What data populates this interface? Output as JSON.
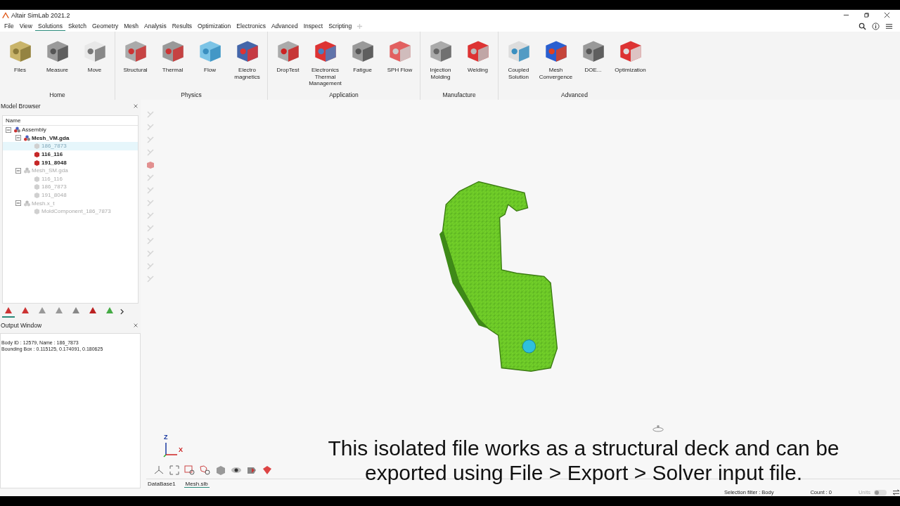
{
  "window": {
    "title": "Altair SimLab 2021.2"
  },
  "menu": [
    {
      "label": "File",
      "selected": false
    },
    {
      "label": "View",
      "selected": false
    },
    {
      "label": "Solutions",
      "selected": true
    },
    {
      "label": "Sketch",
      "selected": false
    },
    {
      "label": "Geometry",
      "selected": false
    },
    {
      "label": "Mesh",
      "selected": false
    },
    {
      "label": "Analysis",
      "selected": false
    },
    {
      "label": "Results",
      "selected": false
    },
    {
      "label": "Optimization",
      "selected": false
    },
    {
      "label": "Electronics",
      "selected": false
    },
    {
      "label": "Advanced",
      "selected": false
    },
    {
      "label": "Inspect",
      "selected": false
    },
    {
      "label": "Scripting",
      "selected": false
    }
  ],
  "ribbon": [
    {
      "label": "Home",
      "tools": [
        "Files",
        "Measure",
        "Move"
      ]
    },
    {
      "label": "Physics",
      "tools": [
        "Structural",
        "Thermal",
        "Flow",
        "Electro\nmagnetics"
      ]
    },
    {
      "label": "Application",
      "tools": [
        "DropTest",
        "Electronics\nThermal\nManagement",
        "Fatigue",
        "SPH Flow"
      ]
    },
    {
      "label": "Manufacture",
      "tools": [
        "Injection\nMolding",
        "Welding"
      ]
    },
    {
      "label": "Advanced",
      "tools": [
        "Coupled\nSolution",
        "Mesh\nConvergence",
        "DOE...",
        "Optimization"
      ]
    }
  ],
  "model_browser": {
    "title": "Model Browser",
    "column": "Name",
    "tree": [
      {
        "label": "Assembly",
        "visible": true,
        "selected": false,
        "expanded": true,
        "children": [
          {
            "label": "Mesh_VM.gda",
            "visible": true,
            "selected": false,
            "expanded": true,
            "children": [
              {
                "label": "186_7873",
                "visible": false,
                "selected": true
              },
              {
                "label": "116_116",
                "visible": true,
                "selected": false
              },
              {
                "label": "191_8048",
                "visible": true,
                "selected": false
              }
            ]
          },
          {
            "label": "Mesh_SM.gda",
            "visible": false,
            "selected": false,
            "expanded": true,
            "children": [
              {
                "label": "116_116",
                "visible": false,
                "selected": false
              },
              {
                "label": "186_7873",
                "visible": false,
                "selected": false
              },
              {
                "label": "191_8048",
                "visible": false,
                "selected": false
              }
            ]
          },
          {
            "label": "Mesh.x_t",
            "visible": false,
            "selected": false,
            "expanded": true,
            "children": [
              {
                "label": "MoldComponent_186_7873",
                "visible": false,
                "selected": false
              }
            ]
          }
        ]
      }
    ],
    "tabs": [
      {
        "selected": true
      },
      {
        "selected": false
      },
      {
        "selected": false
      },
      {
        "selected": false
      },
      {
        "selected": false
      },
      {
        "selected": false
      },
      {
        "selected": false
      }
    ]
  },
  "output_window": {
    "title": "Output Window",
    "lines": [
      "Body ID : 12579, Name : 186_7873",
      "Bounding Box : 0.115125, 0.174091, 0.180625"
    ]
  },
  "viewport": {
    "axes": {
      "z": "Z",
      "x": "X"
    },
    "doc_tabs": [
      {
        "label": "DataBase1",
        "selected": false
      },
      {
        "label": "Mesh.slb",
        "selected": true
      }
    ]
  },
  "caption": [
    "This isolated file works as a structural deck and can be",
    "exported using File > Export > Solver input file."
  ],
  "status_bar": {
    "selection_filter": "Selection filter : Body",
    "count": "Count : 0",
    "units": "Units",
    "units_on": false
  }
}
